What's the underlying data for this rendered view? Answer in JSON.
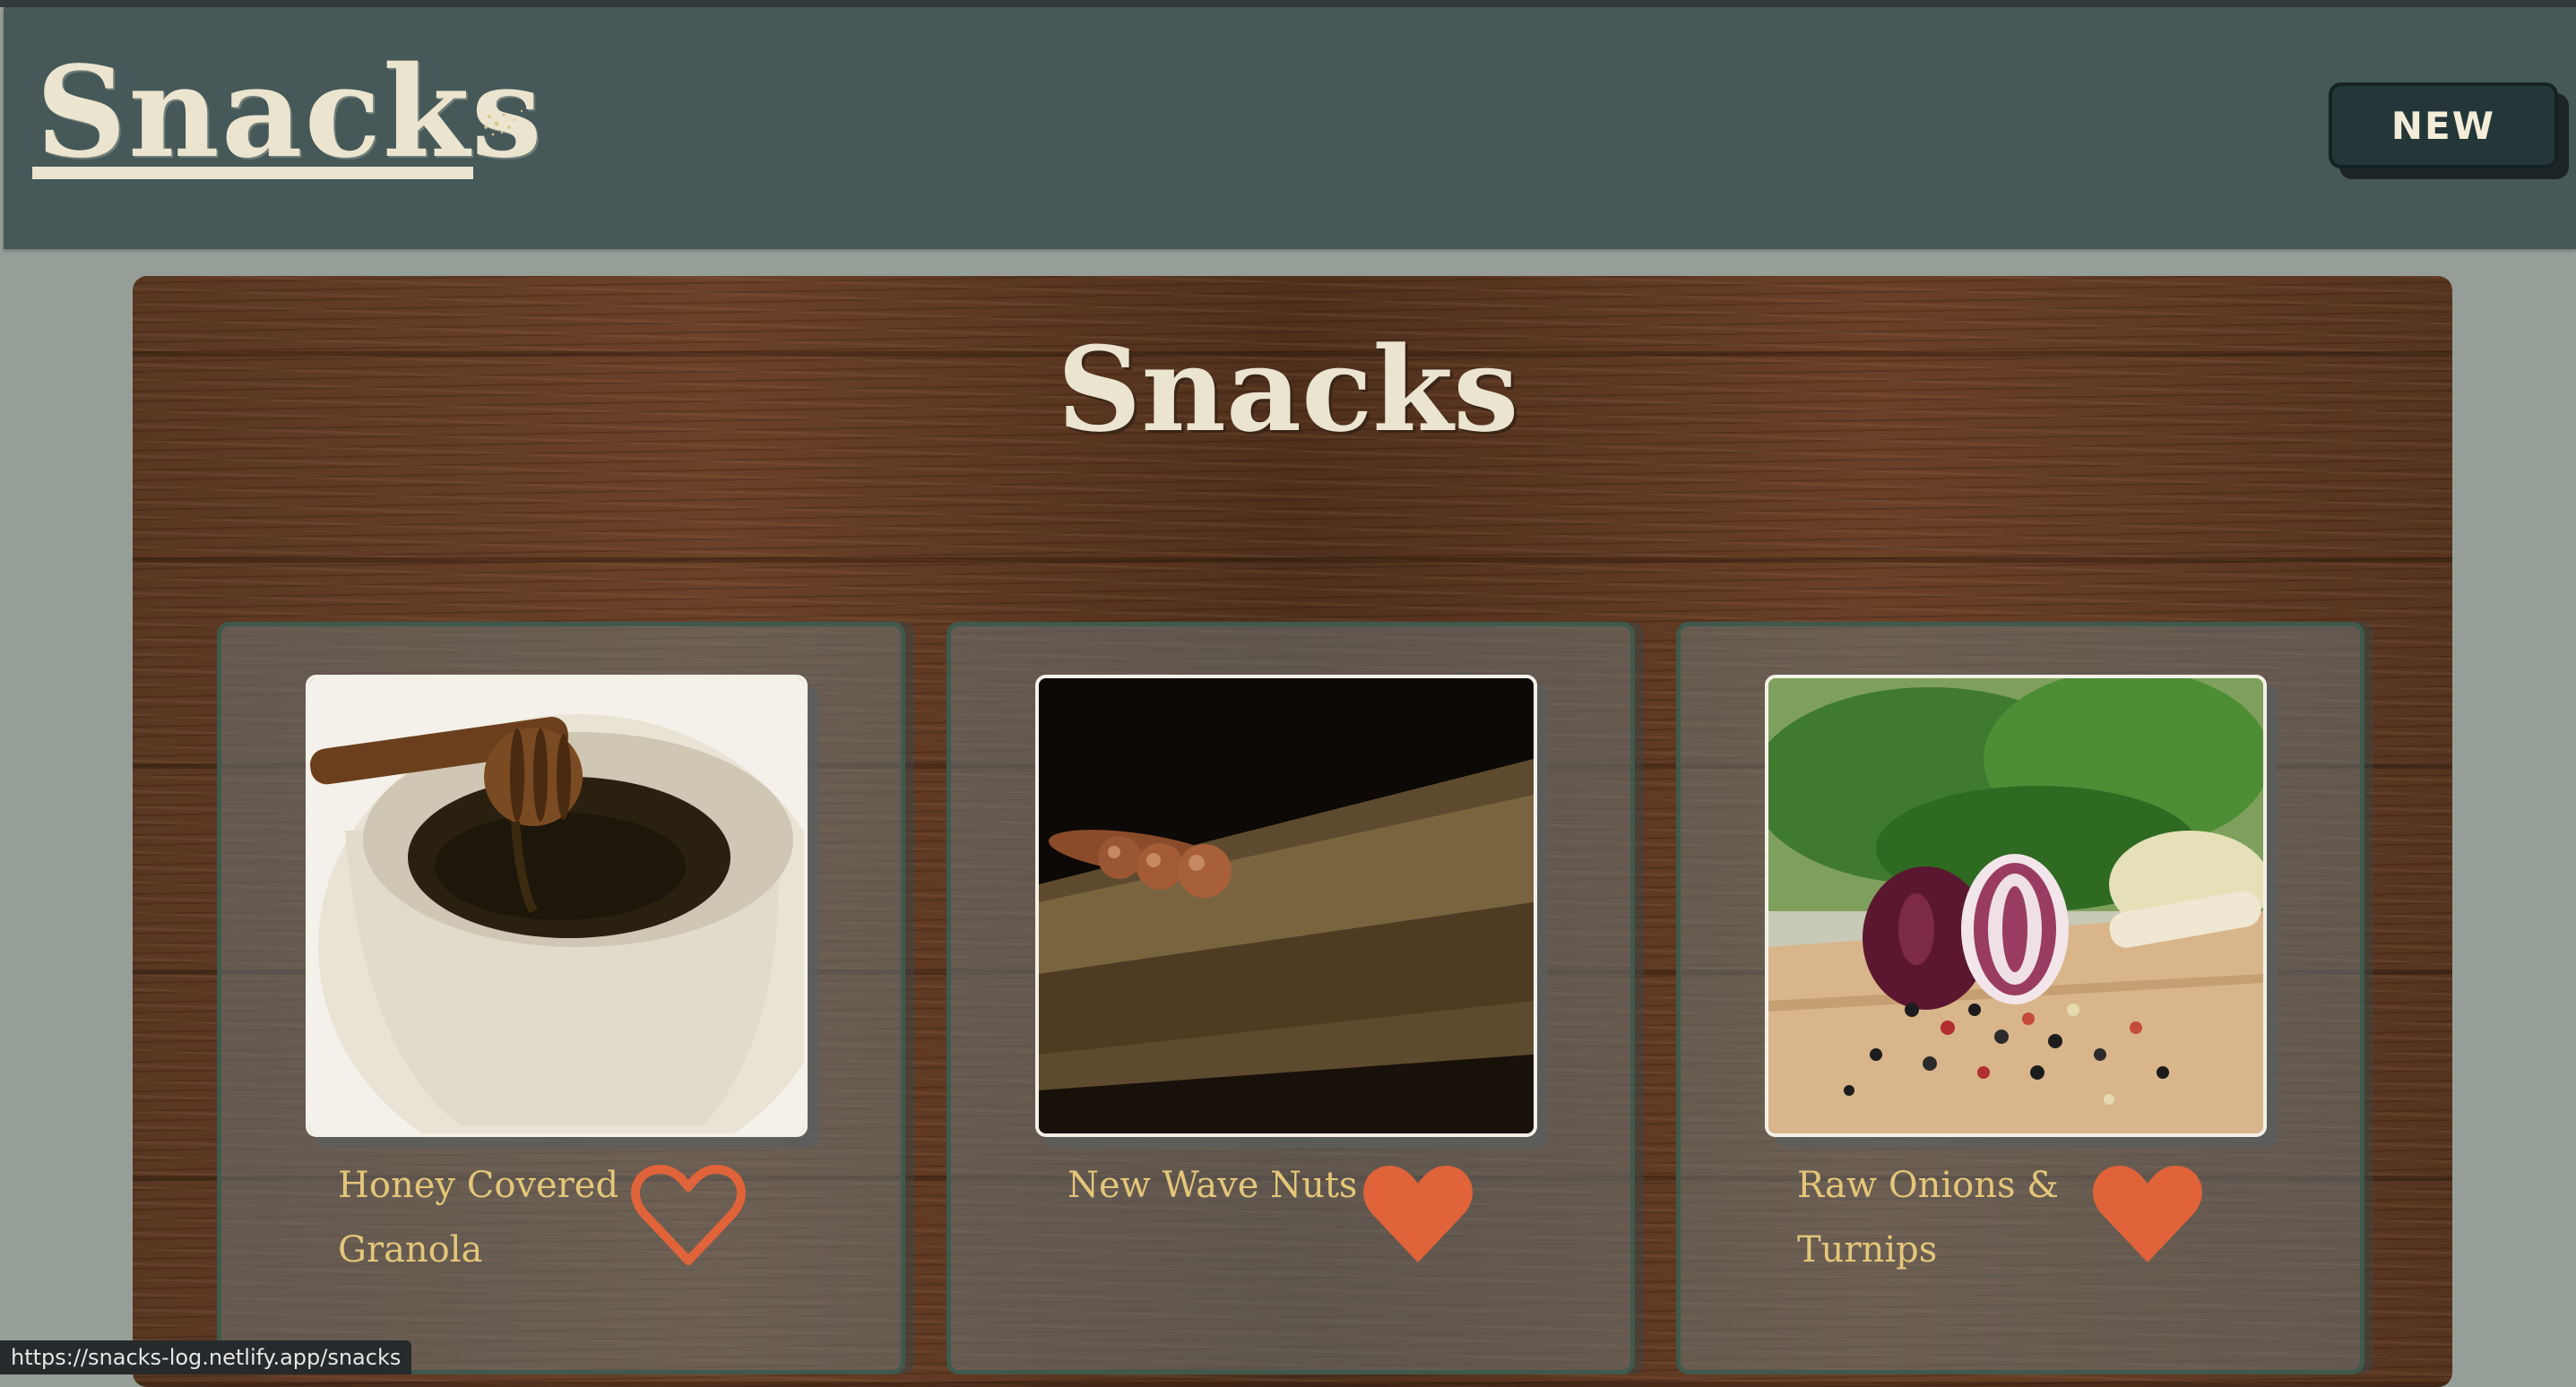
{
  "navbar": {
    "brand": "Snacks",
    "new_button_label": "NEW"
  },
  "board": {
    "title": "Snacks"
  },
  "snacks": [
    {
      "name": "Honey Covered Granola",
      "favorited": false,
      "photo_icon": "honey-jar-photo"
    },
    {
      "name": "New Wave Nuts",
      "favorited": true,
      "photo_icon": "nuts-on-wood-photo"
    },
    {
      "name": "Raw Onions & Turnips",
      "favorited": true,
      "photo_icon": "onions-peppercorns-photo"
    }
  ],
  "status_bar": {
    "url": "https://snacks-log.netlify.app/snacks"
  },
  "colors": {
    "navbar": "#465858",
    "background": "#959f98",
    "button": "#243637",
    "text_cream": "#ebe4cf",
    "name_gold": "#e5c679",
    "heart_orange": "#e0633a"
  }
}
